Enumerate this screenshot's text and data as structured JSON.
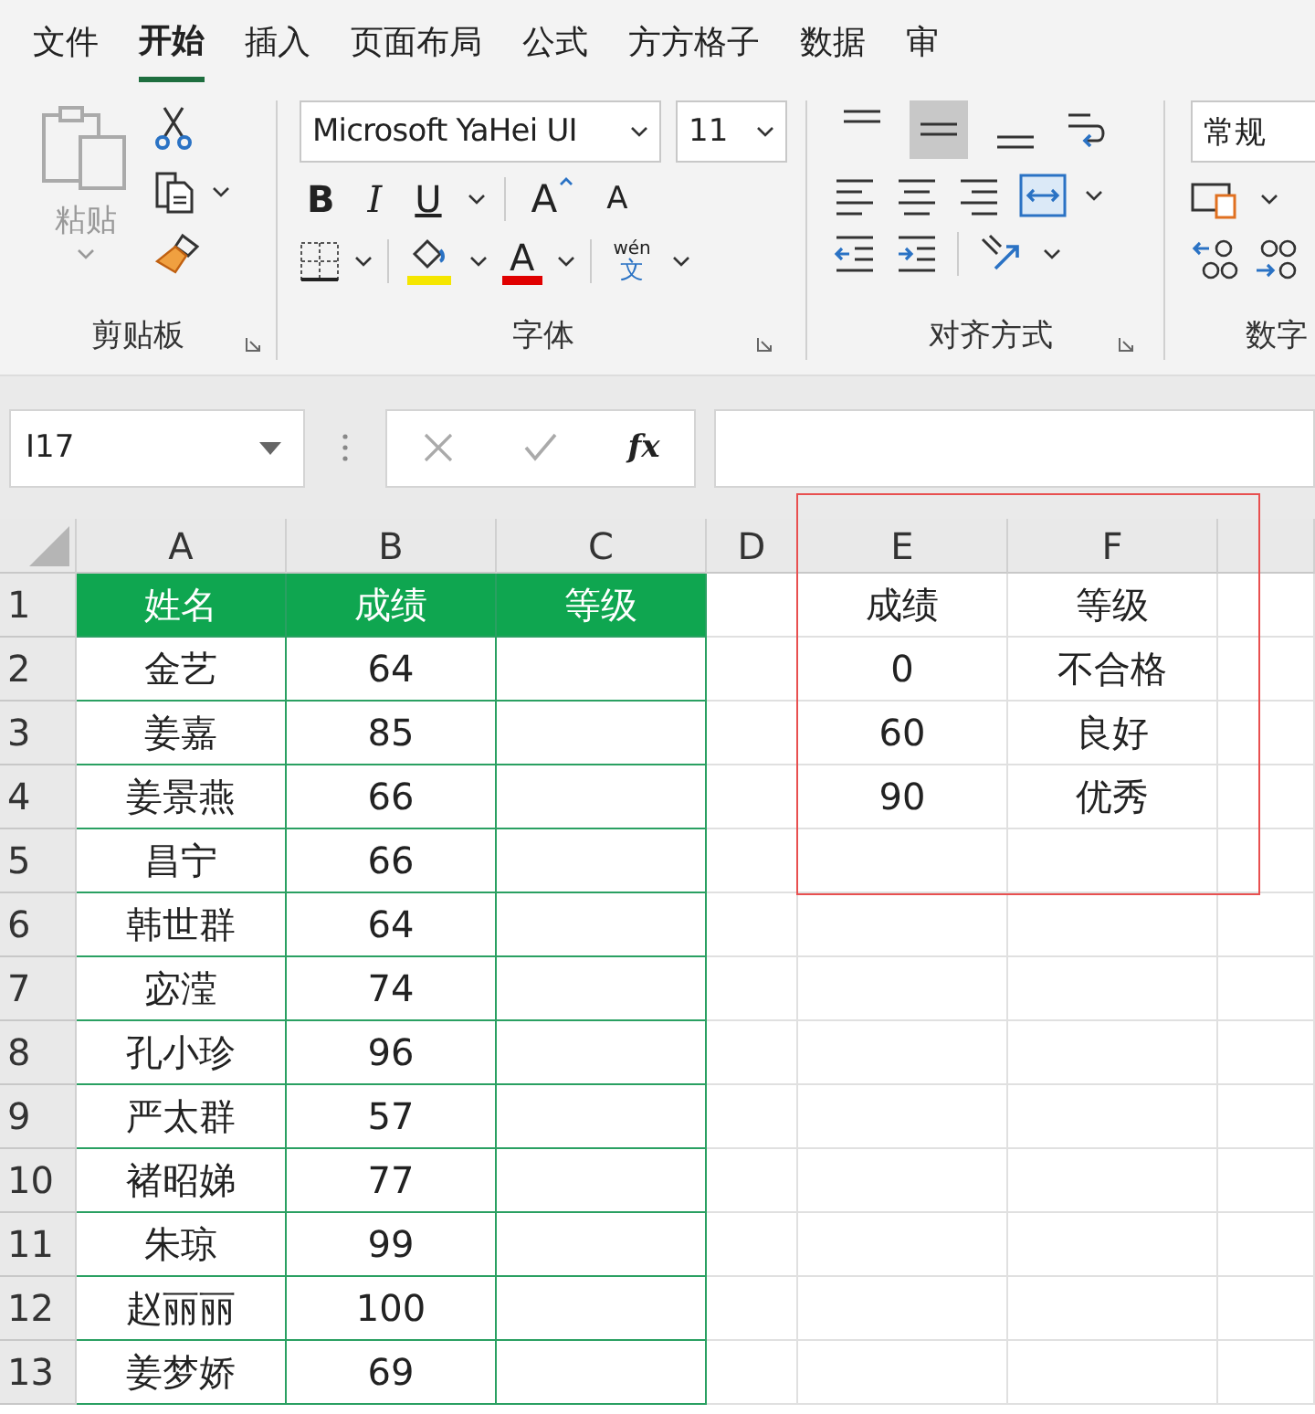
{
  "tabs": [
    {
      "label": "文件",
      "selected": false
    },
    {
      "label": "开始",
      "selected": true
    },
    {
      "label": "插入",
      "selected": false
    },
    {
      "label": "页面布局",
      "selected": false
    },
    {
      "label": "公式",
      "selected": false
    },
    {
      "label": "方方格子",
      "selected": false
    },
    {
      "label": "数据",
      "selected": false
    },
    {
      "label": "审",
      "selected": false
    }
  ],
  "ribbon": {
    "clipboard": {
      "paste": "粘贴",
      "label": "剪贴板"
    },
    "font": {
      "name": "Microsoft YaHei UI",
      "size": "11",
      "bold": "B",
      "italic": "I",
      "underline": "U",
      "grow": "A",
      "shrink": "A",
      "font_color": "A",
      "phonetic_top": "wén",
      "phonetic_bottom": "文",
      "label": "字体"
    },
    "alignment": {
      "vertical": [
        {
          "selected": false
        },
        {
          "selected": true
        },
        {
          "selected": false
        }
      ],
      "label": "对齐方式"
    },
    "number": {
      "format": "常规",
      "label": "数字"
    }
  },
  "formula_bar": {
    "name_box": "I17",
    "fx": "fx"
  },
  "sheet": {
    "columns": [
      "A",
      "B",
      "C",
      "D",
      "E",
      "F"
    ],
    "row_numbers": [
      "1",
      "2",
      "3",
      "4",
      "5",
      "6",
      "7",
      "8",
      "9",
      "10",
      "11",
      "12",
      "13"
    ],
    "table": {
      "headers": [
        "姓名",
        "成绩",
        "等级"
      ],
      "rows": [
        {
          "name": "金艺",
          "score": "64"
        },
        {
          "name": "姜嘉",
          "score": "85"
        },
        {
          "name": "姜景燕",
          "score": "66"
        },
        {
          "name": "昌宁",
          "score": "66"
        },
        {
          "name": "韩世群",
          "score": "64"
        },
        {
          "name": "宓滢",
          "score": "74"
        },
        {
          "name": "孔小珍",
          "score": "96"
        },
        {
          "name": "严太群",
          "score": "57"
        },
        {
          "name": "褚昭娣",
          "score": "77"
        },
        {
          "name": "朱琼",
          "score": "99"
        },
        {
          "name": "赵丽丽",
          "score": "100"
        },
        {
          "name": "姜梦娇",
          "score": "69"
        }
      ]
    },
    "lookup": {
      "headers": [
        "成绩",
        "等级"
      ],
      "rows": [
        {
          "score": "0",
          "grade": "不合格"
        },
        {
          "score": "60",
          "grade": "良好"
        },
        {
          "score": "90",
          "grade": "优秀"
        }
      ]
    }
  }
}
